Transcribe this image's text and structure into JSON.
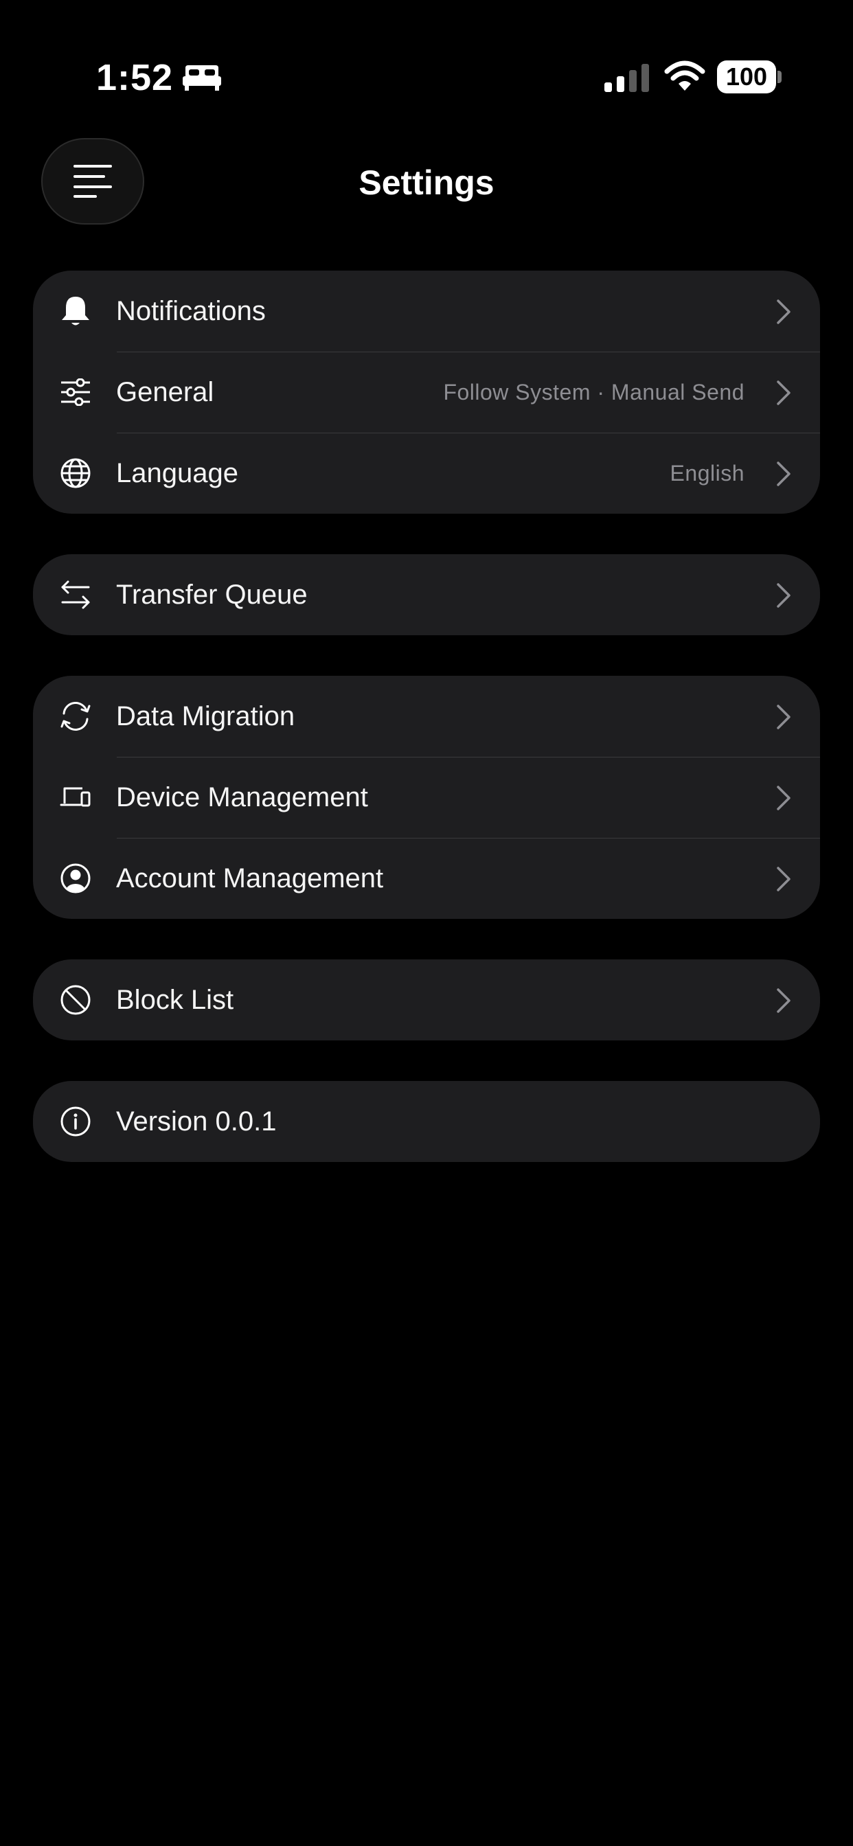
{
  "status_bar": {
    "time": "1:52",
    "battery": "100",
    "icons": [
      "bed-icon",
      "cellular-signal-icon",
      "wifi-icon",
      "battery-icon"
    ]
  },
  "header": {
    "title": "Settings",
    "menu_icon": "menu-lines-icon"
  },
  "groups": [
    {
      "rows": [
        {
          "label": "Notifications",
          "icon": "bell-icon",
          "value": ""
        },
        {
          "label": "General",
          "icon": "sliders-icon",
          "value": "Follow System · Manual Send"
        },
        {
          "label": "Language",
          "icon": "globe-icon",
          "value": "English"
        }
      ]
    },
    {
      "rows": [
        {
          "label": "Transfer Queue",
          "icon": "transfer-arrows-icon",
          "value": ""
        }
      ]
    },
    {
      "rows": [
        {
          "label": "Data Migration",
          "icon": "sync-icon",
          "value": ""
        },
        {
          "label": "Device Management",
          "icon": "devices-icon",
          "value": ""
        },
        {
          "label": "Account Management",
          "icon": "account-circle-icon",
          "value": ""
        }
      ]
    },
    {
      "rows": [
        {
          "label": "Block List",
          "icon": "block-icon",
          "value": ""
        }
      ]
    },
    {
      "rows": [
        {
          "label": "Version 0.0.1",
          "icon": "info-icon",
          "value": ""
        }
      ]
    }
  ]
}
